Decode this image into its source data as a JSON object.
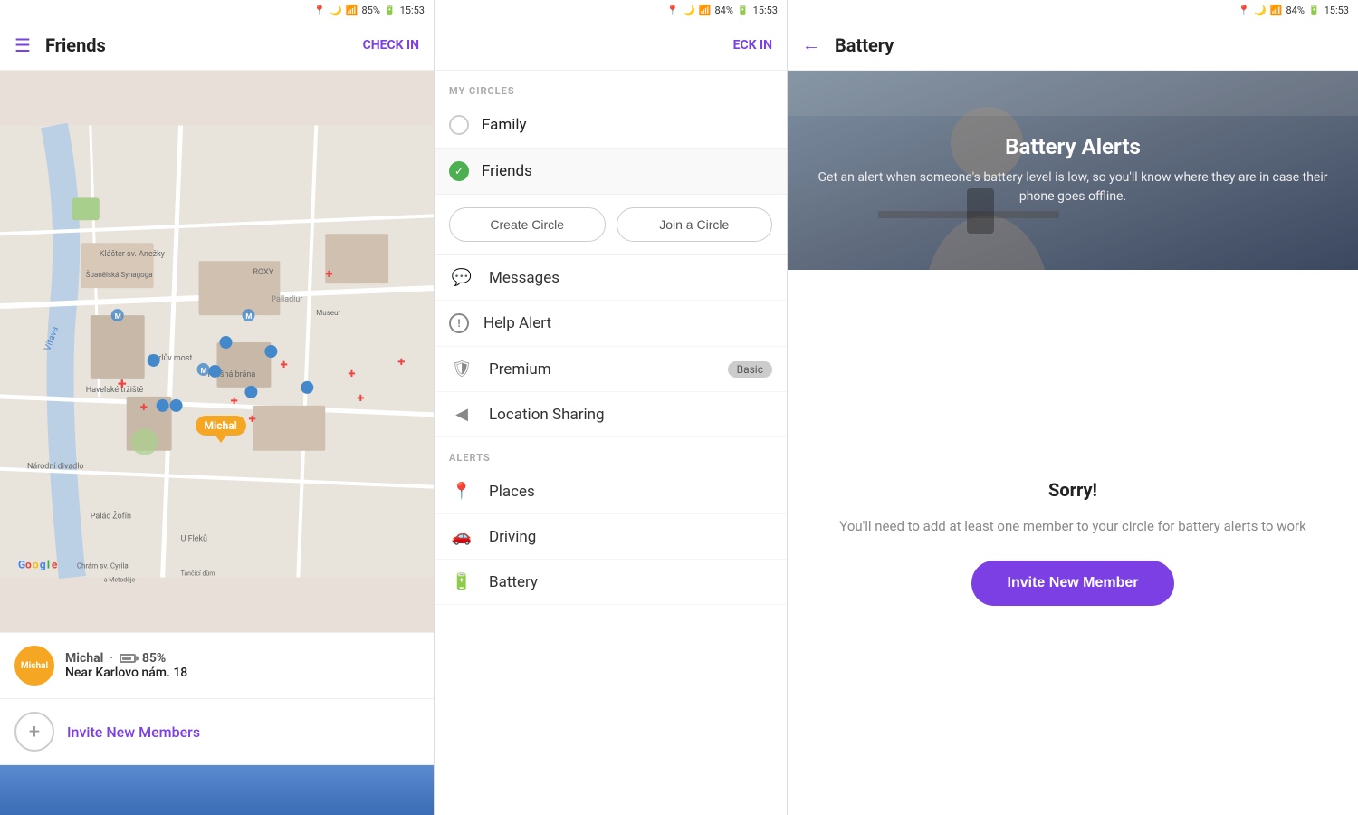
{
  "panel1": {
    "status_bar": {
      "battery": "85%",
      "time": "15:53"
    },
    "app_bar": {
      "title": "Friends",
      "action": "CHECK IN",
      "menu_icon": "☰"
    },
    "map": {
      "marker_label": "Michal"
    },
    "user_card": {
      "avatar_label": "Michal",
      "name": "Michal",
      "battery_percent": "85%",
      "location": "Near Karlovo nám. 18"
    },
    "invite": {
      "text": "Invite New Members",
      "icon": "+"
    }
  },
  "panel2": {
    "status_bar": {
      "battery": "84%",
      "time": "15:53"
    },
    "section_header": "MY CIRCLES",
    "circles": [
      {
        "label": "Family",
        "active": false
      },
      {
        "label": "Friends",
        "active": true
      }
    ],
    "buttons": [
      {
        "label": "Create Circle"
      },
      {
        "label": "Join a Circle"
      }
    ],
    "menu_items": [
      {
        "icon": "💬",
        "label": "Messages"
      },
      {
        "icon": "⊙",
        "label": "Help Alert"
      },
      {
        "icon": "🛡",
        "label": "Premium",
        "badge": "Basic"
      },
      {
        "icon": "◀",
        "label": "Location Sharing"
      }
    ],
    "alerts_header": "ALERTS",
    "alert_items": [
      {
        "icon": "📍",
        "label": "Places"
      },
      {
        "icon": "🚗",
        "label": "Driving"
      },
      {
        "icon": "🔋",
        "label": "Battery"
      }
    ]
  },
  "panel3": {
    "status_bar": {
      "battery": "84%",
      "time": "15:53"
    },
    "app_bar": {
      "title": "Battery",
      "back_icon": "←"
    },
    "hero": {
      "title": "Battery Alerts",
      "description": "Get an alert when someone's battery level is low, so you'll know where they are in case their phone goes offline."
    },
    "sorry": {
      "title": "Sorry!",
      "description": "You'll need to add at least one member to your circle for battery alerts to work"
    },
    "invite_button": "Invite New Member"
  }
}
